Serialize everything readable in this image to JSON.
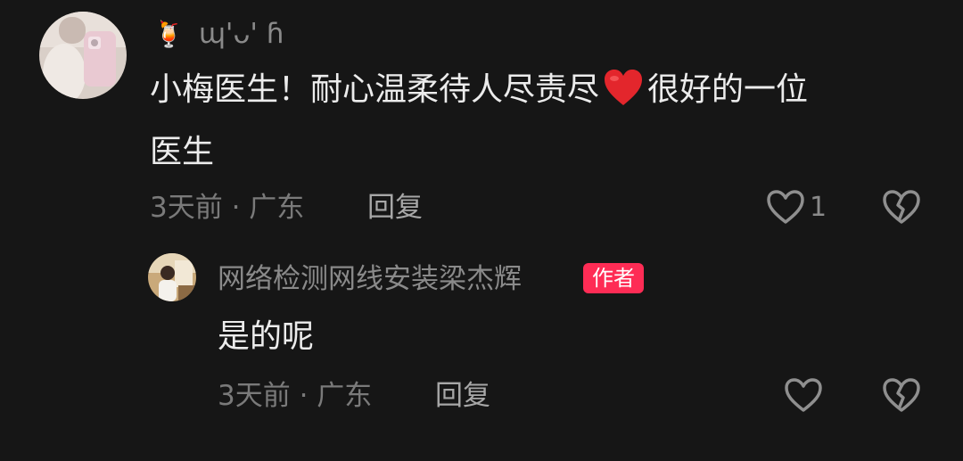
{
  "colors": {
    "background": "#161616",
    "text_primary": "#ececec",
    "text_secondary": "#8a8a8a",
    "author_badge": "#fe2c55",
    "heart_emoji": "#e3262c"
  },
  "comment": {
    "emoji_prefix": "🍹",
    "username": "ɰ'ᴗ' ɦ",
    "text_part1": "小梅医生！耐心温柔待人尽责尽",
    "emoji_icon": "red-heart-emoji",
    "text_part2": "很好的一位",
    "text_line2": "医生",
    "meta": "3天前 · 广东",
    "reply_label": "回复",
    "like_count": "1",
    "like_icon": "heart-outline-icon",
    "dislike_icon": "broken-heart-icon"
  },
  "reply": {
    "username": "网络检测网线安装梁杰辉",
    "badge": "作者",
    "text": "是的呢",
    "meta": "3天前 · 广东",
    "reply_label": "回复",
    "like_icon": "heart-outline-icon",
    "dislike_icon": "broken-heart-icon"
  }
}
